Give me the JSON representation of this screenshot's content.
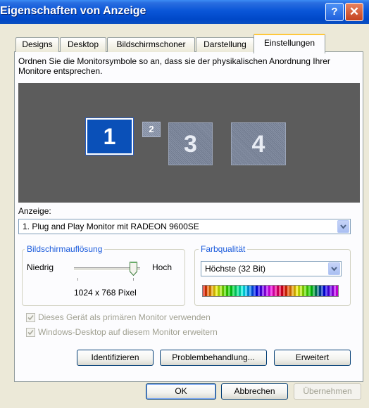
{
  "window": {
    "title": "Eigenschaften von Anzeige"
  },
  "titlebar_buttons": {
    "help": "?",
    "close": "✕"
  },
  "tabs": [
    {
      "label": "Designs"
    },
    {
      "label": "Desktop"
    },
    {
      "label": "Bildschirmschoner"
    },
    {
      "label": "Darstellung"
    },
    {
      "label": "Einstellungen",
      "active": true
    }
  ],
  "settings": {
    "instruction": "Ordnen Sie die Monitorsymbole so an, dass sie der physikalischen Anordnung Ihrer Monitore entsprechen.",
    "monitors": [
      {
        "number": "1",
        "selected": true
      },
      {
        "number": "2"
      },
      {
        "number": "3"
      },
      {
        "number": "4"
      }
    ],
    "display_label": "Anzeige:",
    "display_value": "1. Plug and Play Monitor mit RADEON 9600SE",
    "resolution": {
      "group_title": "Bildschirmauflösung",
      "low": "Niedrig",
      "high": "Hoch",
      "value": "1024 x 768 Pixel",
      "slider_level": 0.85
    },
    "color_quality": {
      "group_title": "Farbqualität",
      "value": "Höchste (32 Bit)"
    },
    "checkboxes": [
      {
        "label": "Dieses Gerät als primären Monitor verwenden",
        "checked": true,
        "disabled": true
      },
      {
        "label": "Windows-Desktop auf diesem Monitor erweitern",
        "checked": true,
        "disabled": true
      }
    ],
    "buttons": {
      "identify": "Identifizieren",
      "troubleshoot": "Problembehandlung...",
      "advanced": "Erweitert"
    }
  },
  "dialog_buttons": {
    "ok": "OK",
    "cancel": "Abbrechen",
    "apply": "Übernehmen"
  },
  "colors": {
    "titlebar": "#0a56d8",
    "active_tab_highlight": "#ffc83c",
    "group_title": "#1c5cdc",
    "selected_monitor": "#0a50b8",
    "monitor_area": "#5c5c5c"
  }
}
